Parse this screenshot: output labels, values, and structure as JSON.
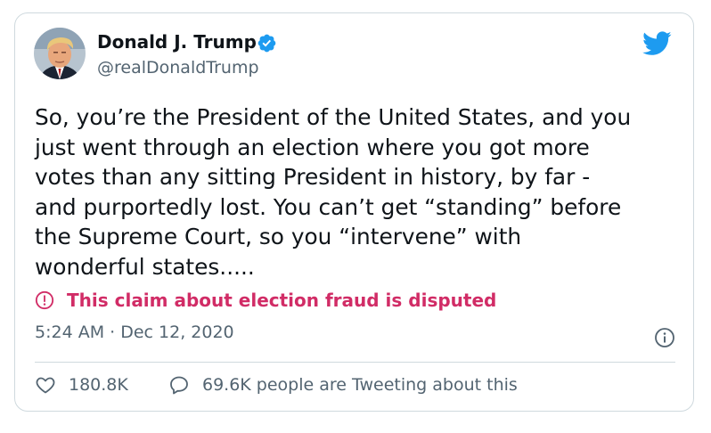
{
  "author": {
    "name": "Donald J. Trump",
    "handle": "@realDonaldTrump"
  },
  "tweet": {
    "text": "So, you’re the President of the United States, and you\njust went through an election where you got more\nvotes than any sitting President in history, by far -\nand purportedly lost. You can’t get “standing” before\nthe Supreme Court, so you “intervene” with\nwonderful states.....",
    "dispute_notice": "This claim about election fraud is disputed",
    "timestamp": "5:24 AM · Dec 12, 2020"
  },
  "stats": {
    "likes": "180.8K",
    "conversation": "69.6K people are Tweeting about this"
  },
  "icons": {
    "brand": "twitter-bird-icon",
    "verified": "verified-badge-icon",
    "warning": "warning-icon",
    "info": "info-icon",
    "like": "heart-icon",
    "reply": "speech-bubble-icon"
  },
  "colors": {
    "brand_blue": "#1d9bf0",
    "dispute_red": "#d12c66",
    "secondary_text": "#536471",
    "border": "#cfd9de"
  }
}
